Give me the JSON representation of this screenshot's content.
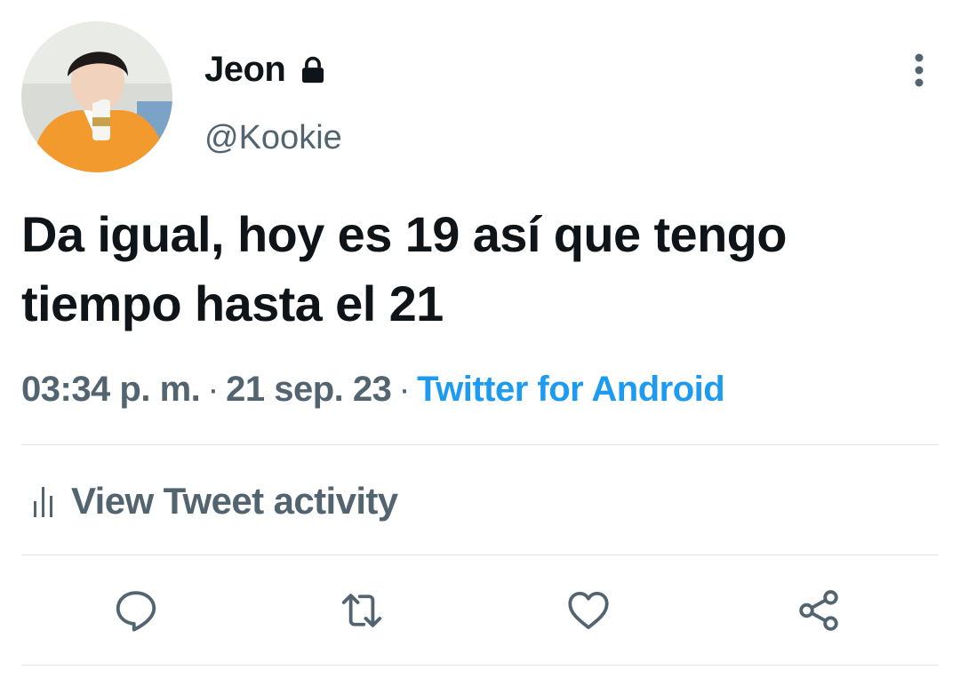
{
  "tweet": {
    "display_name": "Jeon",
    "handle": "@Kookie",
    "text": "Da igual, hoy es 19 así que tengo tiempo hasta el 21",
    "time": "03:34 p. m.",
    "date": "21 sep. 23",
    "separator": "·",
    "source": "Twitter for Android",
    "protected": true
  },
  "activity": {
    "label": "View Tweet activity"
  },
  "icons": {
    "lock": "lock-icon",
    "more": "more-vertical-icon",
    "activity": "bar-chart-icon",
    "reply": "reply-icon",
    "retweet": "retweet-icon",
    "like": "heart-icon",
    "share": "share-icon"
  },
  "colors": {
    "text": "#0f1419",
    "secondary": "#536471",
    "link": "#1d9bf0",
    "divider": "#e1e5e8"
  }
}
